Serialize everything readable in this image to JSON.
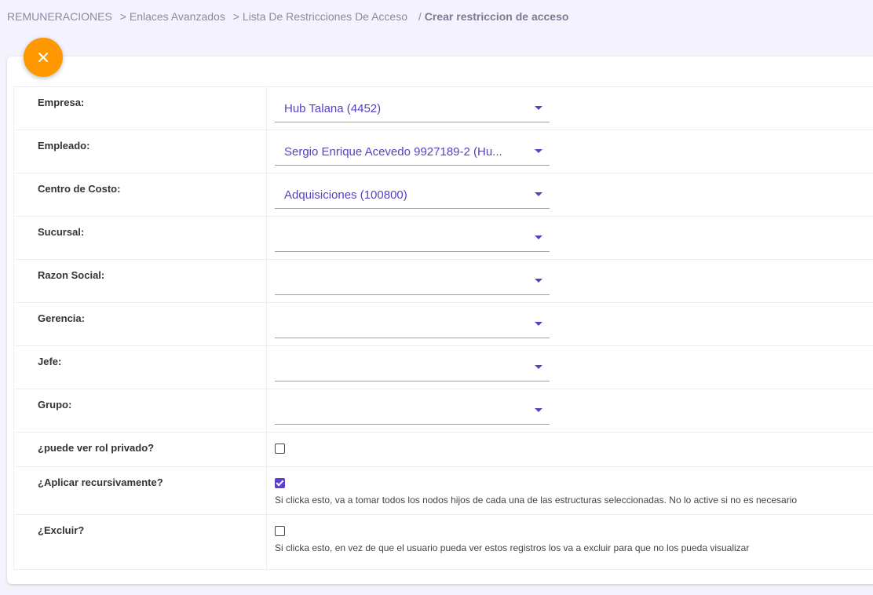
{
  "breadcrumb": {
    "items": [
      "REMUNERACIONES",
      "Enlaces Avanzados",
      "Lista De Restricciones De Acceso"
    ],
    "current": "Crear restriccion de acceso",
    "separator": ">",
    "current_separator": "/"
  },
  "form": {
    "empresa": {
      "label": "Empresa:",
      "value": "Hub Talana (4452)"
    },
    "empleado": {
      "label": "Empleado:",
      "value": "Sergio Enrique Acevedo 9927189-2 (Hu..."
    },
    "centro_costo": {
      "label": "Centro de Costo:",
      "value": "Adquisiciones (100800)"
    },
    "sucursal": {
      "label": "Sucursal:",
      "value": ""
    },
    "razon_social": {
      "label": "Razon Social:",
      "value": ""
    },
    "gerencia": {
      "label": "Gerencia:",
      "value": ""
    },
    "jefe": {
      "label": "Jefe:",
      "value": ""
    },
    "grupo": {
      "label": "Grupo:",
      "value": ""
    },
    "rol_privado": {
      "label": "¿puede ver rol privado?",
      "checked": false
    },
    "recursivo": {
      "label": "¿Aplicar recursivamente?",
      "checked": true,
      "help": "Si clicka esto, va a tomar todos los nodos hijos de cada una de las estructuras seleccionadas. No lo active si no es necesario"
    },
    "excluir": {
      "label": "¿Excluir?",
      "checked": false,
      "help": "Si clicka esto, en vez de que el usuario pueda ver estos registros los va a excluir para que no los pueda visualizar"
    }
  },
  "colors": {
    "accent": "#5a3fc0",
    "fab": "#ff9800",
    "background": "#f4f2fc"
  },
  "icons": {
    "close_button": "close-icon",
    "dropdown": "caret-down-icon"
  }
}
